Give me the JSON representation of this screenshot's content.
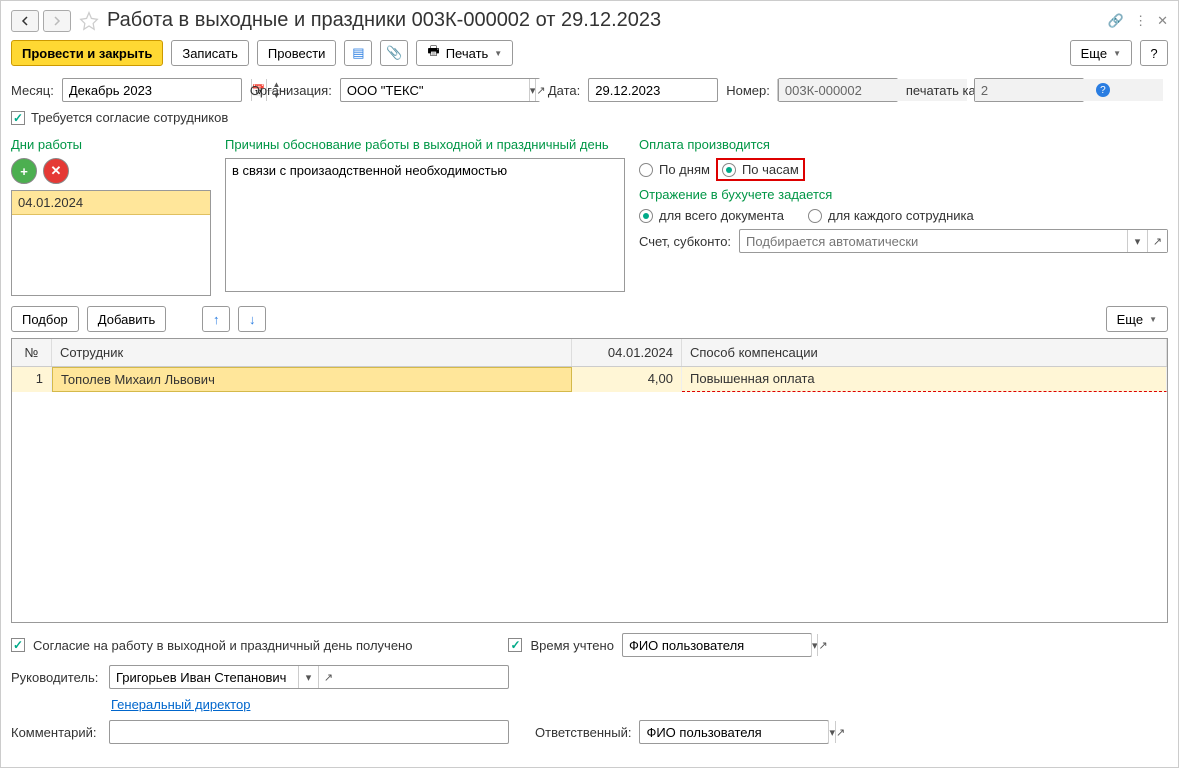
{
  "title": "Работа в выходные и праздники 003К-000002 от 29.12.2023",
  "toolbar": {
    "post_close": "Провести и закрыть",
    "save": "Записать",
    "post": "Провести",
    "print": "Печать",
    "more": "Еще",
    "help": "?"
  },
  "fields": {
    "month_label": "Месяц:",
    "month_value": "Декабрь 2023",
    "org_label": "Организация:",
    "org_value": "ООО \"ТЕКС\"",
    "date_label": "Дата:",
    "date_value": "29.12.2023",
    "number_label": "Номер:",
    "number_value": "003К-000002",
    "print_as_label": "печатать как:",
    "print_as_value": "2"
  },
  "consent_required": "Требуется согласие сотрудников",
  "days": {
    "label": "Дни работы",
    "items": [
      "04.01.2024"
    ]
  },
  "reasons": {
    "label": "Причины обоснование работы в выходной и праздничный день",
    "text": "в связи с произаодственной необходимостью"
  },
  "payment": {
    "label": "Оплата производится",
    "by_days": "По дням",
    "by_hours": "По часам"
  },
  "accounting": {
    "label": "Отражение в бухучете задается",
    "whole_doc": "для всего документа",
    "each_emp": "для каждого сотрудника",
    "account_label": "Счет, субконто:",
    "account_placeholder": "Подбирается автоматически"
  },
  "table_toolbar": {
    "select": "Подбор",
    "add": "Добавить",
    "more": "Еще"
  },
  "table": {
    "col_num": "№",
    "col_emp": "Сотрудник",
    "col_date": "04.01.2024",
    "col_comp": "Способ компенсации",
    "rows": [
      {
        "n": "1",
        "emp": "Тополев Михаил Львович",
        "hours": "4,00",
        "comp": "Повышенная оплата"
      }
    ]
  },
  "bottom": {
    "consent_received": "Согласие на работу в выходной и праздничный день получено",
    "time_accounted": "Время учтено",
    "user_fio": "ФИО пользователя",
    "manager_label": "Руководитель:",
    "manager_value": "Григорьев Иван Степанович",
    "position_link": "Генеральный директор",
    "comment_label": "Комментарий:",
    "responsible_label": "Ответственный:",
    "responsible_value": "ФИО пользователя"
  }
}
